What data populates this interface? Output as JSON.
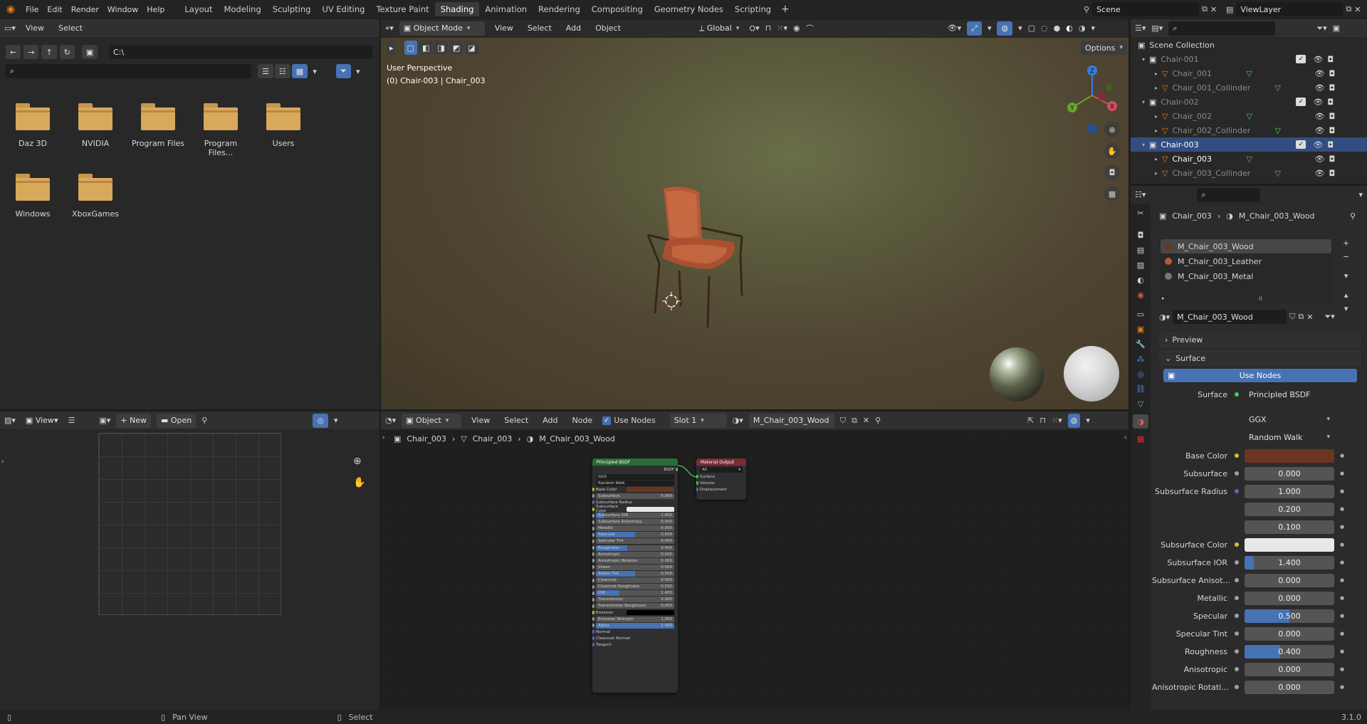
{
  "topbar": {
    "menus": [
      "File",
      "Edit",
      "Render",
      "Window",
      "Help"
    ],
    "workspaces": [
      "Layout",
      "Modeling",
      "Sculpting",
      "UV Editing",
      "Texture Paint",
      "Shading",
      "Animation",
      "Rendering",
      "Compositing",
      "Geometry Nodes",
      "Scripting"
    ],
    "active_workspace": "Shading",
    "scene": "Scene",
    "view_layer": "ViewLayer"
  },
  "filebrowser": {
    "menus": [
      "View",
      "Select"
    ],
    "path": "C:\\",
    "folders": [
      "Daz 3D",
      "NVIDIA",
      "Program Files",
      "Program Files...",
      "Users",
      "Windows",
      "XboxGames"
    ]
  },
  "imgeditor": {
    "view": "View",
    "new": "New",
    "open": "Open"
  },
  "viewport": {
    "mode": "Object Mode",
    "menus": [
      "View",
      "Select",
      "Add",
      "Object"
    ],
    "orientation": "Global",
    "options": "Options",
    "overlay_line1": "User Perspective",
    "overlay_line2": "(0) Chair-003 | Chair_003"
  },
  "nodeeditor": {
    "mode": "Object",
    "menus": [
      "View",
      "Select",
      "Add",
      "Node"
    ],
    "use_nodes": "Use Nodes",
    "slot": "Slot 1",
    "material": "M_Chair_003_Wood",
    "breadcrumb": [
      "Chair_003",
      "Chair_003",
      "M_Chair_003_Wood"
    ],
    "bsdf_title": "Principled BSDF",
    "output_title": "Material Output",
    "bsdf_out": "BSDF",
    "output_target": "All",
    "output_inputs": [
      "Surface",
      "Volume",
      "Displacement"
    ],
    "bsdf_rows": [
      {
        "label": "GGX",
        "value": ""
      },
      {
        "label": "Random Walk",
        "value": ""
      },
      {
        "label": "Base Color",
        "value": ""
      },
      {
        "label": "Subsurface",
        "value": "0.000"
      },
      {
        "label": "Subsurface Radius",
        "value": ""
      },
      {
        "label": "Subsurface Color",
        "value": ""
      },
      {
        "label": "Subsurface IOR",
        "value": "1.400"
      },
      {
        "label": "Subsurface Anisotropy",
        "value": "0.000"
      },
      {
        "label": "Metallic",
        "value": "0.000"
      },
      {
        "label": "Specular",
        "value": "0.500"
      },
      {
        "label": "Specular Tint",
        "value": "0.000"
      },
      {
        "label": "Roughness",
        "value": "0.400"
      },
      {
        "label": "Anisotropic",
        "value": "0.000"
      },
      {
        "label": "Anisotropic Rotation",
        "value": "0.000"
      },
      {
        "label": "Sheen",
        "value": "0.000"
      },
      {
        "label": "Sheen Tint",
        "value": "0.500"
      },
      {
        "label": "Clearcoat",
        "value": "0.000"
      },
      {
        "label": "Clearcoat Roughness",
        "value": "0.030"
      },
      {
        "label": "IOR",
        "value": "1.450"
      },
      {
        "label": "Transmission",
        "value": "0.000"
      },
      {
        "label": "Transmission Roughness",
        "value": "0.000"
      },
      {
        "label": "Emission",
        "value": ""
      },
      {
        "label": "Emission Strength",
        "value": "1.000"
      },
      {
        "label": "Alpha",
        "value": "1.000"
      },
      {
        "label": "Normal",
        "value": ""
      },
      {
        "label": "Clearcoat Normal",
        "value": ""
      },
      {
        "label": "Tangent",
        "value": ""
      }
    ]
  },
  "outliner": {
    "root": "Scene Collection",
    "items": [
      {
        "label": "Chair-001",
        "level": 1,
        "type": "collection"
      },
      {
        "label": "Chair_001",
        "level": 2,
        "type": "object"
      },
      {
        "label": "Chair_001_Collinder",
        "level": 2,
        "type": "object"
      },
      {
        "label": "Chair-002",
        "level": 1,
        "type": "collection"
      },
      {
        "label": "Chair_002",
        "level": 2,
        "type": "object"
      },
      {
        "label": "Chair_002_Collinder",
        "level": 2,
        "type": "object"
      },
      {
        "label": "Chair-003",
        "level": 1,
        "type": "collection"
      },
      {
        "label": "Chair_003",
        "level": 2,
        "type": "object"
      },
      {
        "label": "Chair_003_Collinder",
        "level": 2,
        "type": "object"
      }
    ],
    "selected": "Chair-003"
  },
  "properties": {
    "breadcrumb_object": "Chair_003",
    "breadcrumb_material": "M_Chair_003_Wood",
    "slots": [
      "M_Chair_003_Wood",
      "M_Chair_003_Leather",
      "M_Chair_003_Metal"
    ],
    "material_name": "M_Chair_003_Wood",
    "preview": "Preview",
    "surface_panel": "Surface",
    "use_nodes": "Use Nodes",
    "surface_label": "Surface",
    "surface_value": "Principled BSDF",
    "distribution": "GGX",
    "subsurface_method": "Random Walk",
    "rows": [
      {
        "label": "Base Color",
        "value": "",
        "kind": "color",
        "color": "#6a3622",
        "socket": "#c7c729"
      },
      {
        "label": "Subsurface",
        "value": "0.000",
        "kind": "num",
        "fill": 0,
        "socket": "#a0a0a0"
      },
      {
        "label": "Subsurface Radius",
        "value": "1.000",
        "kind": "num",
        "fill": 0,
        "socket": "#6363c7"
      },
      {
        "label": "",
        "value": "0.200",
        "kind": "num",
        "fill": 0,
        "socket": ""
      },
      {
        "label": "",
        "value": "0.100",
        "kind": "num",
        "fill": 0,
        "socket": ""
      },
      {
        "label": "Subsurface Color",
        "value": "",
        "kind": "color",
        "color": "#e8e8e8",
        "socket": "#c7c729"
      },
      {
        "label": "Subsurface IOR",
        "value": "1.400",
        "kind": "num",
        "fill": 0.1,
        "socket": "#a0a0a0"
      },
      {
        "label": "Subsurface Anisot...",
        "value": "0.000",
        "kind": "num",
        "fill": 0,
        "socket": "#a0a0a0"
      },
      {
        "label": "Metallic",
        "value": "0.000",
        "kind": "num",
        "fill": 0,
        "socket": "#a0a0a0"
      },
      {
        "label": "Specular",
        "value": "0.500",
        "kind": "num",
        "fill": 0.5,
        "socket": "#a0a0a0"
      },
      {
        "label": "Specular Tint",
        "value": "0.000",
        "kind": "num",
        "fill": 0,
        "socket": "#a0a0a0"
      },
      {
        "label": "Roughness",
        "value": "0.400",
        "kind": "num",
        "fill": 0.4,
        "socket": "#a0a0a0"
      },
      {
        "label": "Anisotropic",
        "value": "0.000",
        "kind": "num",
        "fill": 0,
        "socket": "#a0a0a0"
      },
      {
        "label": "Anisotropic Rotati...",
        "value": "0.000",
        "kind": "num",
        "fill": 0,
        "socket": "#a0a0a0"
      }
    ]
  },
  "statusbar": {
    "left_hint": "Pan View",
    "right_hint": "Select",
    "version": "3.1.0"
  }
}
